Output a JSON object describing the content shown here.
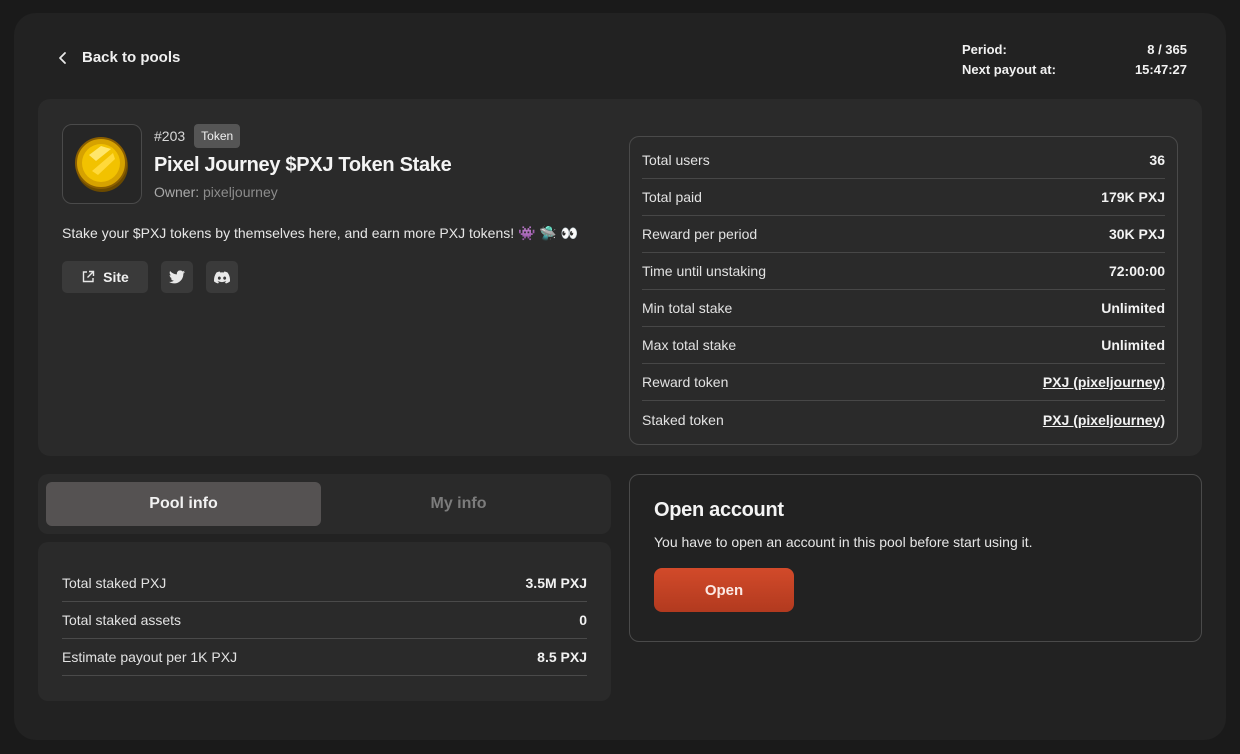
{
  "header": {
    "back_label": "Back to pools",
    "period_label": "Period:",
    "period_value": "8 / 365",
    "payout_label": "Next payout at:",
    "payout_value": "15:47:27"
  },
  "pool": {
    "number": "#203",
    "badge": "Token",
    "title": "Pixel Journey $PXJ Token Stake",
    "owner_label": "Owner:",
    "owner_name": "pixeljourney",
    "description": "Stake your $PXJ tokens by themselves here, and earn more PXJ tokens! 👾 🛸 👀",
    "logo_icon": "gold-coin-icon",
    "links": {
      "site_label": "Site",
      "site_icon": "external-link-icon",
      "twitter_icon": "twitter-icon",
      "discord_icon": "discord-icon"
    }
  },
  "stats": [
    {
      "label": "Total users",
      "value": "36"
    },
    {
      "label": "Total paid",
      "value": "179K PXJ"
    },
    {
      "label": "Reward per period",
      "value": "30K PXJ"
    },
    {
      "label": "Time until unstaking",
      "value": "72:00:00"
    },
    {
      "label": "Min total stake",
      "value": "Unlimited"
    },
    {
      "label": "Max total stake",
      "value": "Unlimited"
    },
    {
      "label": "Reward token",
      "value": "PXJ (pixeljourney)"
    },
    {
      "label": "Staked token",
      "value": "PXJ (pixeljourney)"
    }
  ],
  "tabs": [
    {
      "label": "Pool info",
      "active": true
    },
    {
      "label": "My info",
      "active": false
    }
  ],
  "pool_info": [
    {
      "label": "Total staked PXJ",
      "value": "3.5M PXJ"
    },
    {
      "label": "Total staked assets",
      "value": "0"
    },
    {
      "label": "Estimate payout per 1K PXJ",
      "value": "8.5 PXJ"
    }
  ],
  "account": {
    "title": "Open account",
    "text": "You have to open an account in this pool before start using it.",
    "button_label": "Open"
  },
  "colors": {
    "accent": "#c8432a",
    "background": "#1a1a1a",
    "panel": "#2a2a2a"
  }
}
